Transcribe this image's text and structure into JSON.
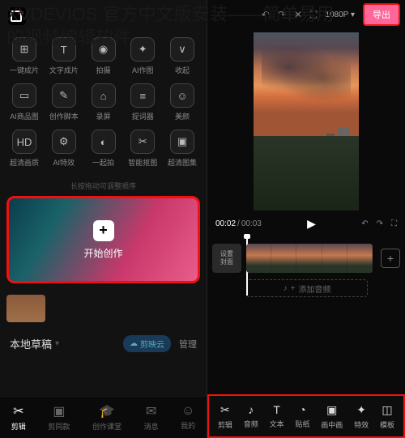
{
  "overlay_title": "XVDEVIOS 官方中文版安装——简单易用的视频编辑软件",
  "left": {
    "tool_rows": [
      [
        {
          "icon": "⊞",
          "label": "一键成片"
        },
        {
          "icon": "T",
          "label": "文字成片"
        },
        {
          "icon": "◉",
          "label": "拍摄"
        },
        {
          "icon": "✦",
          "label": "AI作图"
        },
        {
          "icon": "∨",
          "label": "收起"
        }
      ],
      [
        {
          "icon": "▭",
          "label": "AI商品图"
        },
        {
          "icon": "✎",
          "label": "创作脚本"
        },
        {
          "icon": "⌂",
          "label": "录屏"
        },
        {
          "icon": "≡",
          "label": "提词器"
        },
        {
          "icon": "☺",
          "label": "美颜"
        }
      ],
      [
        {
          "icon": "HD",
          "label": "超清画质"
        },
        {
          "icon": "⚙",
          "label": "AI特效"
        },
        {
          "icon": "◐",
          "label": "一起拍"
        },
        {
          "icon": "✂",
          "label": "智能抠图"
        },
        {
          "icon": "▣",
          "label": "超清图集"
        }
      ]
    ],
    "hint": "长按拖动可调整顺序",
    "create_label": "开始创作",
    "draft_title": "本地草稿",
    "cloud_label": "剪映云",
    "manage_label": "管理",
    "nav": [
      {
        "icon": "✂",
        "label": "剪辑",
        "active": true
      },
      {
        "icon": "▣",
        "label": "剪同款"
      },
      {
        "icon": "🎓",
        "label": "创作课堂"
      },
      {
        "icon": "✉",
        "label": "消息"
      },
      {
        "icon": "☺",
        "label": "我的"
      }
    ]
  },
  "right": {
    "resolution": "1080P",
    "export_label": "导出",
    "time_current": "00:02",
    "time_total": "00:03",
    "cover_line1": "设置",
    "cover_line2": "封面",
    "audio_label": "添加音频",
    "edit_items": [
      {
        "icon": "✂",
        "label": "剪辑"
      },
      {
        "icon": "♪",
        "label": "音频"
      },
      {
        "icon": "T",
        "label": "文本"
      },
      {
        "icon": "◔",
        "label": "贴纸"
      },
      {
        "icon": "▣",
        "label": "画中画"
      },
      {
        "icon": "✦",
        "label": "特效"
      },
      {
        "icon": "◫",
        "label": "模板"
      }
    ]
  }
}
